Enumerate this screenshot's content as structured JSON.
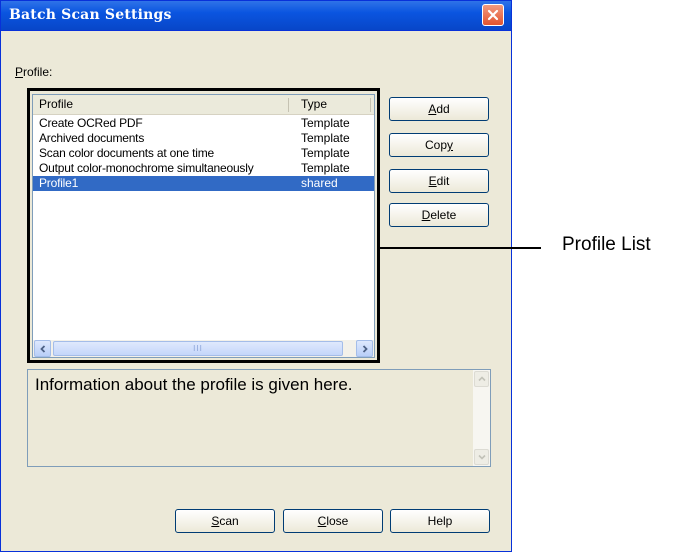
{
  "window": {
    "title": "Batch Scan Settings"
  },
  "profile_label": {
    "prefix": "P",
    "rest": "rofile:"
  },
  "list": {
    "columns": [
      "Profile",
      "Type"
    ],
    "rows": [
      {
        "name": "Create OCRed PDF",
        "type": "Template",
        "selected": false
      },
      {
        "name": "Archived documents",
        "type": "Template",
        "selected": false
      },
      {
        "name": "Scan color documents at one time",
        "type": "Template",
        "selected": false
      },
      {
        "name": "Output color-monochrome simultaneously",
        "type": "Template",
        "selected": false
      },
      {
        "name": "Profile1",
        "type": "shared",
        "selected": true
      }
    ],
    "scroll_thumb_grip": "III"
  },
  "buttons": {
    "add": {
      "hot": "A",
      "rest": "dd"
    },
    "copy": {
      "pre": "Cop",
      "hot": "y"
    },
    "edit": {
      "hot": "E",
      "rest": "dit"
    },
    "delete": {
      "hot": "D",
      "rest": "elete"
    },
    "scan": {
      "hot": "S",
      "rest": "can"
    },
    "close": {
      "hot": "C",
      "rest": "lose"
    },
    "help": "Help"
  },
  "info": {
    "text": "Information about the profile is given here."
  },
  "annotation": {
    "label": "Profile List"
  },
  "colors": {
    "titlebar": "#0a55e0",
    "selection": "#316ac5",
    "dialog_bg": "#ece9d8"
  }
}
